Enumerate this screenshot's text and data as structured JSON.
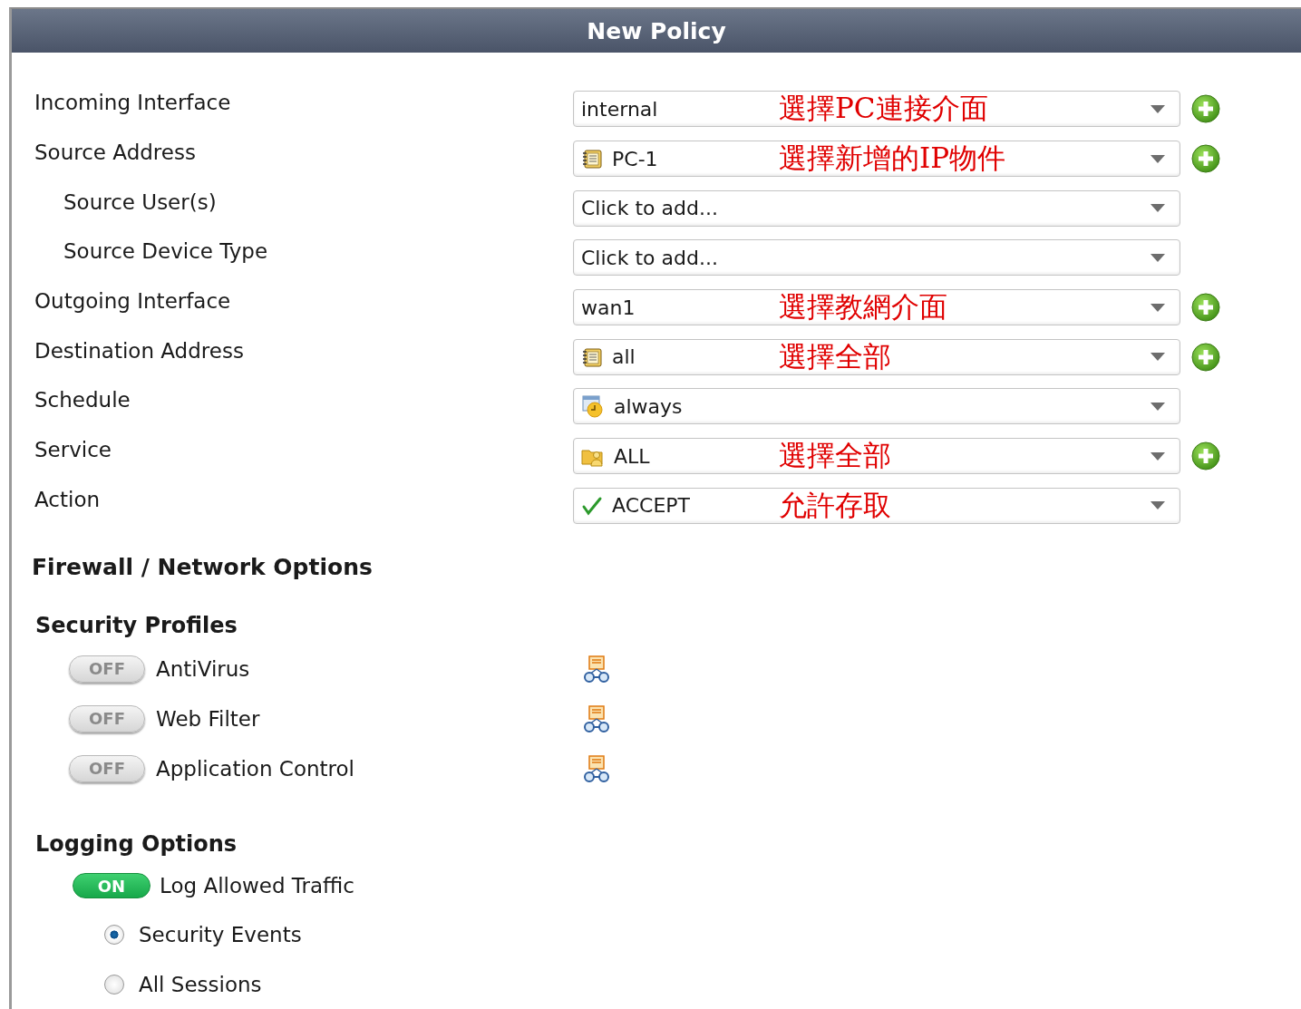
{
  "window": {
    "title": "New Policy"
  },
  "fields": [
    {
      "label": "Incoming Interface",
      "value": "internal",
      "annotation": "選擇PC連接介面",
      "add_button": true
    },
    {
      "label": "Source Address",
      "kind": "address",
      "value": "PC-1",
      "annotation": "選擇新增的IP物件",
      "add_button": true,
      "children": [
        {
          "label": "Source User(s)",
          "placeholder": "Click to add..."
        },
        {
          "label": "Source Device Type",
          "placeholder": "Click to add..."
        }
      ]
    },
    {
      "label": "Outgoing Interface",
      "value": "wan1",
      "annotation": "選擇教網介面",
      "add_button": true
    },
    {
      "label": "Destination Address",
      "kind": "address",
      "value": "all",
      "annotation": "選擇全部",
      "add_button": true
    },
    {
      "label": "Schedule",
      "kind": "schedule",
      "value": "always"
    },
    {
      "label": "Service",
      "kind": "service",
      "value": "ALL",
      "annotation": "選擇全部",
      "add_button": true
    },
    {
      "label": "Action",
      "kind": "accept",
      "value": "ACCEPT",
      "annotation": "允許存取"
    }
  ],
  "firewall_heading": "Firewall / Network Options",
  "security_profiles": {
    "heading": "Security Profiles",
    "items": [
      {
        "label": "AntiVirus",
        "on": false,
        "toggle_text": "OFF"
      },
      {
        "label": "Web Filter",
        "on": false,
        "toggle_text": "OFF"
      },
      {
        "label": "Application Control",
        "on": false,
        "toggle_text": "OFF"
      }
    ]
  },
  "logging": {
    "heading": "Logging Options",
    "toggle": {
      "label": "Log Allowed Traffic",
      "on": true,
      "toggle_text": "ON"
    },
    "options": [
      {
        "label": "Security Events",
        "selected": true
      },
      {
        "label": "All Sessions",
        "selected": false
      }
    ]
  }
}
